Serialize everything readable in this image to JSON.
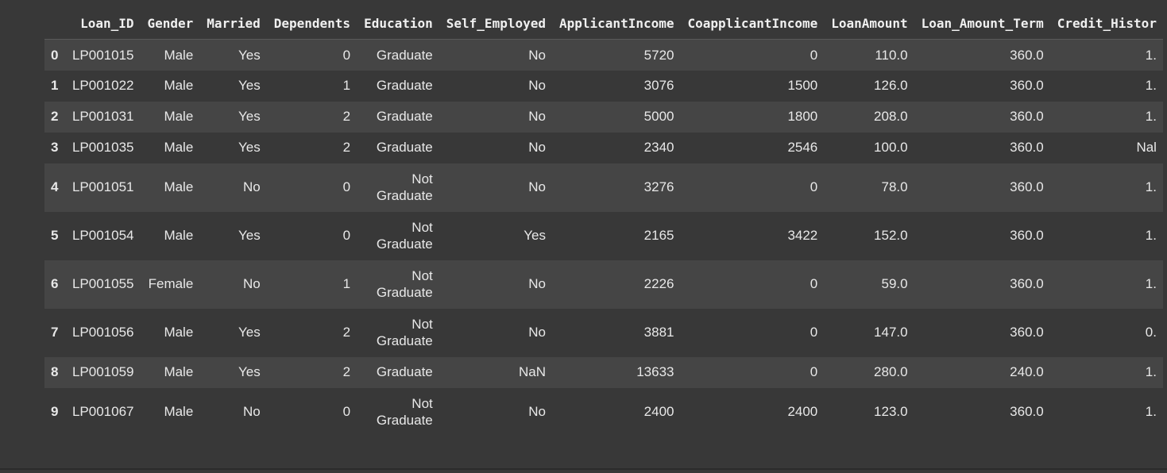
{
  "table": {
    "columns": [
      "Loan_ID",
      "Gender",
      "Married",
      "Dependents",
      "Education",
      "Self_Employed",
      "ApplicantIncome",
      "CoapplicantIncome",
      "LoanAmount",
      "Loan_Amount_Term",
      "Credit_Histor"
    ],
    "rows": [
      {
        "index": "0",
        "Loan_ID": "LP001015",
        "Gender": "Male",
        "Married": "Yes",
        "Dependents": "0",
        "Education": "Graduate",
        "Self_Employed": "No",
        "ApplicantIncome": "5720",
        "CoapplicantIncome": "0",
        "LoanAmount": "110.0",
        "Loan_Amount_Term": "360.0",
        "Credit_History": "1."
      },
      {
        "index": "1",
        "Loan_ID": "LP001022",
        "Gender": "Male",
        "Married": "Yes",
        "Dependents": "1",
        "Education": "Graduate",
        "Self_Employed": "No",
        "ApplicantIncome": "3076",
        "CoapplicantIncome": "1500",
        "LoanAmount": "126.0",
        "Loan_Amount_Term": "360.0",
        "Credit_History": "1."
      },
      {
        "index": "2",
        "Loan_ID": "LP001031",
        "Gender": "Male",
        "Married": "Yes",
        "Dependents": "2",
        "Education": "Graduate",
        "Self_Employed": "No",
        "ApplicantIncome": "5000",
        "CoapplicantIncome": "1800",
        "LoanAmount": "208.0",
        "Loan_Amount_Term": "360.0",
        "Credit_History": "1."
      },
      {
        "index": "3",
        "Loan_ID": "LP001035",
        "Gender": "Male",
        "Married": "Yes",
        "Dependents": "2",
        "Education": "Graduate",
        "Self_Employed": "No",
        "ApplicantIncome": "2340",
        "CoapplicantIncome": "2546",
        "LoanAmount": "100.0",
        "Loan_Amount_Term": "360.0",
        "Credit_History": "Nal"
      },
      {
        "index": "4",
        "Loan_ID": "LP001051",
        "Gender": "Male",
        "Married": "No",
        "Dependents": "0",
        "Education": "Not Graduate",
        "Self_Employed": "No",
        "ApplicantIncome": "3276",
        "CoapplicantIncome": "0",
        "LoanAmount": "78.0",
        "Loan_Amount_Term": "360.0",
        "Credit_History": "1."
      },
      {
        "index": "5",
        "Loan_ID": "LP001054",
        "Gender": "Male",
        "Married": "Yes",
        "Dependents": "0",
        "Education": "Not Graduate",
        "Self_Employed": "Yes",
        "ApplicantIncome": "2165",
        "CoapplicantIncome": "3422",
        "LoanAmount": "152.0",
        "Loan_Amount_Term": "360.0",
        "Credit_History": "1."
      },
      {
        "index": "6",
        "Loan_ID": "LP001055",
        "Gender": "Female",
        "Married": "No",
        "Dependents": "1",
        "Education": "Not Graduate",
        "Self_Employed": "No",
        "ApplicantIncome": "2226",
        "CoapplicantIncome": "0",
        "LoanAmount": "59.0",
        "Loan_Amount_Term": "360.0",
        "Credit_History": "1."
      },
      {
        "index": "7",
        "Loan_ID": "LP001056",
        "Gender": "Male",
        "Married": "Yes",
        "Dependents": "2",
        "Education": "Not Graduate",
        "Self_Employed": "No",
        "ApplicantIncome": "3881",
        "CoapplicantIncome": "0",
        "LoanAmount": "147.0",
        "Loan_Amount_Term": "360.0",
        "Credit_History": "0."
      },
      {
        "index": "8",
        "Loan_ID": "LP001059",
        "Gender": "Male",
        "Married": "Yes",
        "Dependents": "2",
        "Education": "Graduate",
        "Self_Employed": "NaN",
        "ApplicantIncome": "13633",
        "CoapplicantIncome": "0",
        "LoanAmount": "280.0",
        "Loan_Amount_Term": "240.0",
        "Credit_History": "1."
      },
      {
        "index": "9",
        "Loan_ID": "LP001067",
        "Gender": "Male",
        "Married": "No",
        "Dependents": "0",
        "Education": "Not Graduate",
        "Self_Employed": "No",
        "ApplicantIncome": "2400",
        "CoapplicantIncome": "2400",
        "LoanAmount": "123.0",
        "Loan_Amount_Term": "360.0",
        "Credit_History": "1."
      }
    ]
  },
  "colors": {
    "background": "#383838",
    "row_alt": "#454545",
    "text": "#e8e8e8"
  }
}
